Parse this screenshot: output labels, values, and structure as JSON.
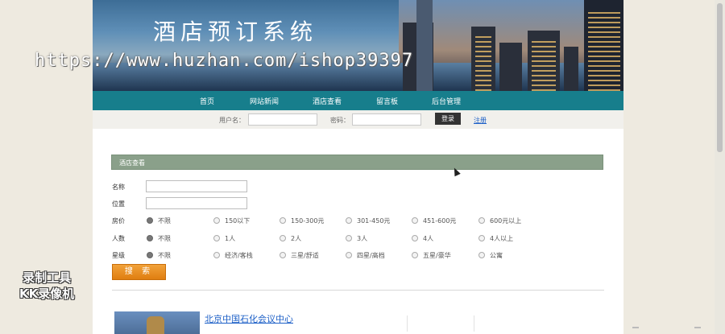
{
  "banner": {
    "title": "酒店预订系统"
  },
  "watermark": {
    "text": "https://www.huzhan.com/ishop39397"
  },
  "nav": {
    "items": [
      "首页",
      "网站新闻",
      "酒店查看",
      "留言板",
      "后台管理"
    ]
  },
  "login": {
    "username_label": "用户名：",
    "password_label": "密码：",
    "login_button": "登录",
    "register_link": "注册"
  },
  "section": {
    "title": "酒店查看"
  },
  "form": {
    "name_label": "名称",
    "location_label": "位置",
    "price_label": "房价",
    "price_options": [
      "不限",
      "150以下",
      "150-300元",
      "301-450元",
      "451-600元",
      "600元以上"
    ],
    "people_label": "人数",
    "people_options": [
      "不限",
      "1人",
      "2人",
      "3人",
      "4人",
      "4人以上"
    ],
    "star_label": "星级",
    "star_options": [
      "不限",
      "经济/客栈",
      "三星/舒适",
      "四星/高档",
      "五星/豪华",
      "公寓"
    ],
    "selected_index": 0,
    "search_button": "搜 索"
  },
  "results": [
    {
      "name": "北京中国石化会议中心"
    }
  ],
  "recorder": {
    "line1": "录制工具",
    "line2": "KK录像机"
  }
}
